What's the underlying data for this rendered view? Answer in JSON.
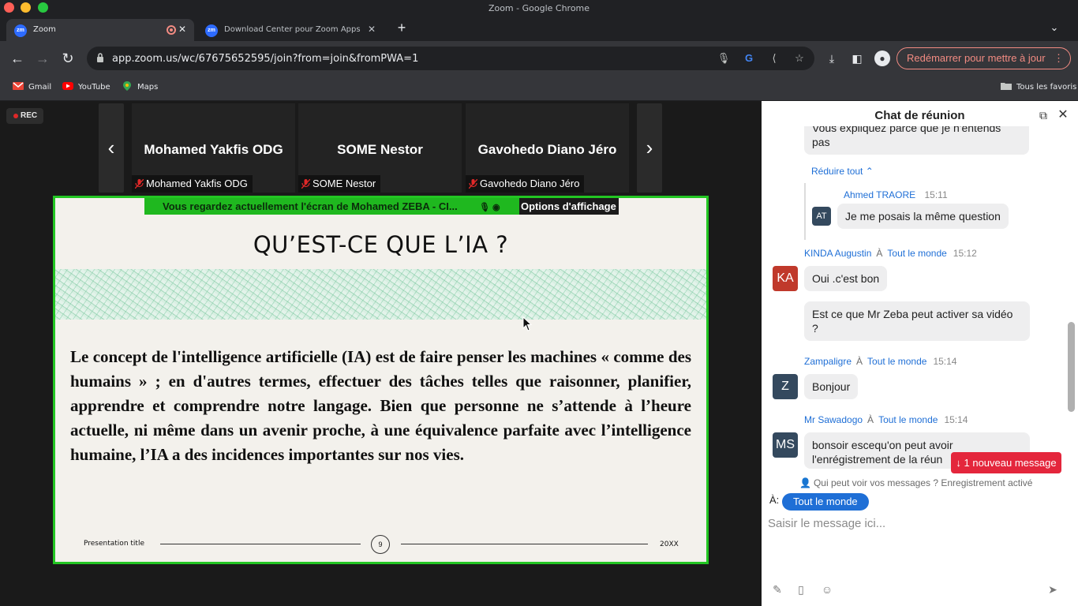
{
  "window": {
    "title": "Zoom - Google Chrome"
  },
  "tabs": [
    {
      "title": "Zoom",
      "favicon": "zm"
    },
    {
      "title": "Download Center pour Zoom Apps et modu",
      "favicon": "zm"
    }
  ],
  "toolbar": {
    "url": "app.zoom.us/wc/67675652595/join?from=join&fromPWA=1",
    "relaunch_label": "Redémarrer pour mettre à jour"
  },
  "bookmarks": {
    "items": [
      "Gmail",
      "YouTube",
      "Maps"
    ],
    "all_label": "Tous les favoris"
  },
  "meeting": {
    "rec_label": "REC",
    "participants": [
      {
        "name": "Mohamed Yakfis ODG",
        "label": "Mohamed Yakfis ODG"
      },
      {
        "name": "SOME Nestor",
        "label": "SOME Nestor"
      },
      {
        "name": "Gavohedo Diano Jéro",
        "label": "Gavohedo Diano Jéro"
      }
    ],
    "share_banner": "Vous regardez actuellement l'écran de  Mohamed ZEBA - CI...",
    "view_options": "Options d'affichage"
  },
  "slide": {
    "title": "QU’EST-CE QUE L’IA ?",
    "body": "Le concept de l'intelligence artificielle (IA) est de faire penser les machines « comme des humains » ; en d'autres termes, effectuer des tâches telles que raisonner, planifier, apprendre et comprendre notre langage. Bien que personne ne s’attende à l’heure actuelle, ni même dans un avenir proche, à une équivalence parfaite avec l’intelligence humaine, l’IA a des incidences importantes sur nos vies.",
    "footer_title": "Presentation title",
    "page_number": "9",
    "year": "20XX"
  },
  "chat": {
    "title": "Chat de réunion",
    "collapse_label": "Réduire tout",
    "top_fragment": "Vous expliquez parce que je n'entends pas",
    "messages": [
      {
        "sender": "Ahmed TRAORE",
        "to_word": "",
        "to": "",
        "time": "15:11",
        "initials": "AT",
        "texts": [
          "Je me posais la même question"
        ]
      },
      {
        "sender": "KINDA Augustin",
        "to_word": "À",
        "to": "Tout le monde",
        "time": "15:12",
        "initials": "KA",
        "texts": [
          "Oui .c'est bon",
          "Est ce que Mr Zeba peut activer sa vidéo ?"
        ]
      },
      {
        "sender": "Zampaligre",
        "to_word": "À",
        "to": "Tout le monde",
        "time": "15:14",
        "initials": "Z",
        "texts": [
          "Bonjour"
        ]
      },
      {
        "sender": "Mr Sawadogo",
        "to_word": "À",
        "to": "Tout le monde",
        "time": "15:14",
        "initials": "MS",
        "texts": [
          "bonsoir escequ'on peut avoir l'enrégistrement de la réun"
        ]
      }
    ],
    "new_message_badge": "↓ 1 nouveau message",
    "privacy_note": "Qui peut voir vos messages ? Enregistrement activé",
    "to_label": "À:",
    "recipient": "Tout le monde",
    "input_placeholder": "Saisir le message ici..."
  },
  "colors": {
    "share_border": "#23c623",
    "banner": "#1fb81f",
    "chat_link": "#1f6fd6",
    "new_message": "#e4263c",
    "avatar_ka": "#c0392b",
    "avatar_default": "#34495e"
  },
  "icons": [
    "back-icon",
    "forward-icon",
    "reload-icon",
    "lock-icon",
    "mic-icon",
    "google-icon",
    "share-icon",
    "star-icon",
    "download-icon",
    "sidepanel-icon",
    "profile-icon",
    "popout-icon",
    "close-icon",
    "format-icon",
    "file-icon",
    "emoji-icon",
    "send-icon",
    "mute-icon"
  ]
}
